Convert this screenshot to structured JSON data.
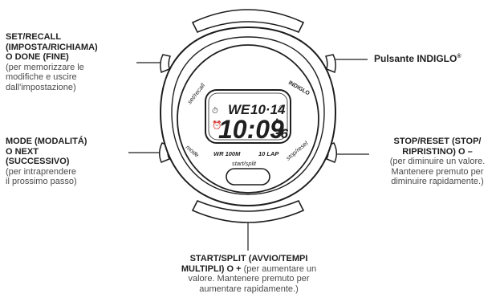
{
  "callouts": {
    "set_recall": {
      "title": "SET/RECALL (IMPOSTA/RICHIAMA) O DONE (FINE)",
      "title_lines": [
        "SET/RECALL",
        "(IMPOSTA/RICHIAMA)",
        "O DONE (FINE)"
      ],
      "desc_lines": [
        "(per memorizzare le",
        "modifiche e uscire",
        "dall'impostazione)"
      ]
    },
    "mode": {
      "title_lines": [
        "MODE (MODALITÁ)",
        "O NEXT",
        "(SUCCESSIVO)"
      ],
      "desc_lines": [
        "(per intraprendere",
        "il prossimo passo)"
      ]
    },
    "indiglo": {
      "label": "Pulsante INDIGLO",
      "mark": "®"
    },
    "stop_reset": {
      "title_lines": [
        "STOP/RESET (STOP/",
        "RIPRISTINO) O –"
      ],
      "desc_lines": [
        "(per diminuire un valore.",
        "Mantenere premuto per",
        "diminuire rapidamente.)"
      ]
    },
    "start_split": {
      "title_line1": "START/SPLIT (AVVIO/TEMPI",
      "title_line2": "MULTIPLI) O +",
      "desc_inline": " (per aumentare un",
      "desc_lines": [
        "valore. Mantenere premuto per",
        "aumentare rapidamente.)"
      ]
    }
  },
  "watch": {
    "bezel_labels": {
      "set_recall": "set/recall",
      "indiglo": "INDIGLO",
      "mode": "mode",
      "stop_reset": "stop/reset",
      "wr": "WR 100M",
      "lap": "10 LAP",
      "start_split": "start/split"
    },
    "display": {
      "day": "WE",
      "date": "10·14",
      "time": "10:09",
      "seconds": "36",
      "ampm": "A"
    }
  }
}
